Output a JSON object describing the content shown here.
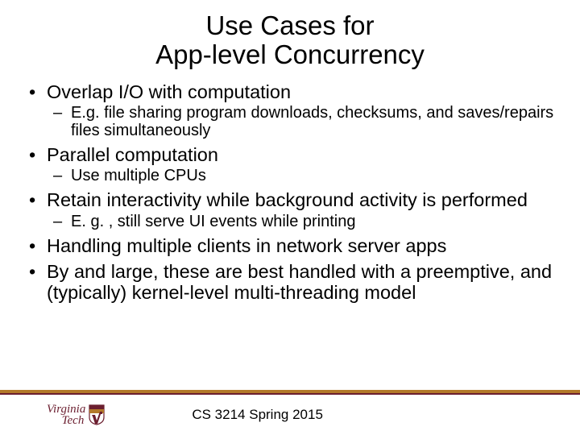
{
  "title_line1": "Use Cases for",
  "title_line2": "App-level Concurrency",
  "bullets": [
    {
      "text": "Overlap I/O with computation",
      "sub": [
        "E.g. file sharing program downloads, checksums, and saves/repairs files simultaneously"
      ]
    },
    {
      "text": "Parallel computation",
      "sub": [
        "Use multiple CPUs"
      ]
    },
    {
      "text": "Retain interactivity while background activity is performed",
      "sub": [
        "E. g. , still serve UI events while printing"
      ]
    },
    {
      "text": "Handling multiple clients in network server apps",
      "sub": []
    },
    {
      "text": "By and large, these are best handled with a preemptive, and (typically) kernel-level multi-threading model",
      "sub": []
    }
  ],
  "logo": {
    "line1": "Virginia",
    "line2": "Tech"
  },
  "footer": "CS 3214 Spring 2015",
  "colors": {
    "maroon": "#6b1e2f",
    "orange": "#b37a2a"
  }
}
